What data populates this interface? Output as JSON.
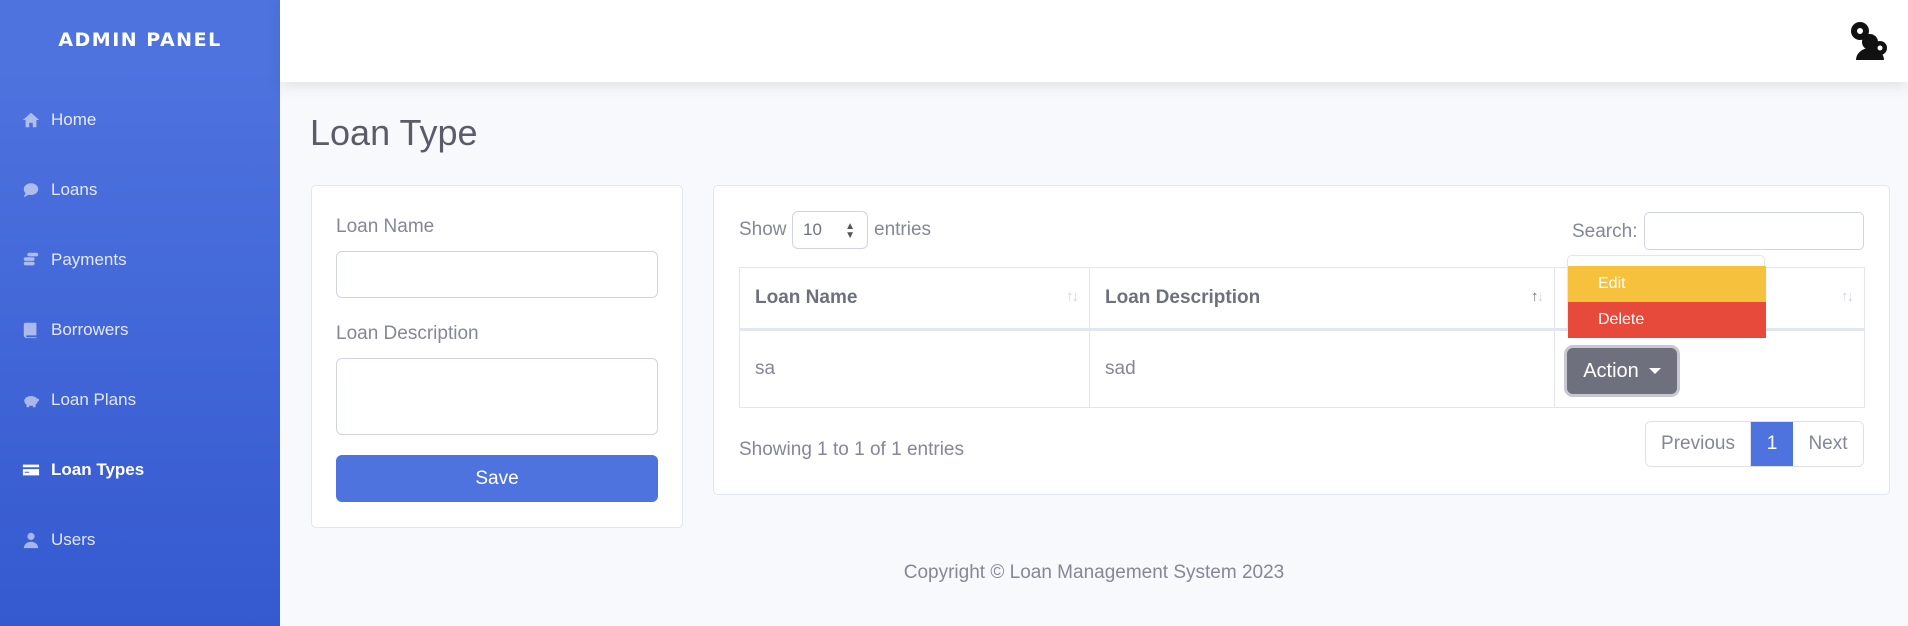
{
  "sidebar": {
    "brand": "ADMIN PANEL",
    "items": [
      {
        "label": "Home",
        "icon": "home-icon"
      },
      {
        "label": "Loans",
        "icon": "comment-dollar-icon"
      },
      {
        "label": "Payments",
        "icon": "coins-icon"
      },
      {
        "label": "Borrowers",
        "icon": "book-icon"
      },
      {
        "label": "Loan Plans",
        "icon": "piggy-bank-icon"
      },
      {
        "label": "Loan Types",
        "icon": "credit-card-icon",
        "active": true
      },
      {
        "label": "Users",
        "icon": "user-icon"
      }
    ]
  },
  "topbar": {
    "user_icon": "users-cog-icon"
  },
  "page": {
    "title": "Loan Type"
  },
  "form": {
    "loan_name_label": "Loan Name",
    "loan_name_value": "",
    "loan_description_label": "Loan Description",
    "loan_description_value": "",
    "save_label": "Save"
  },
  "table": {
    "show_label": "Show",
    "page_size": "10",
    "entries_label": "entries",
    "search_label": "Search:",
    "search_value": "",
    "columns": [
      "Loan Name",
      "Loan Description",
      ""
    ],
    "rows": [
      {
        "loan_name": "sa",
        "loan_description": "sad",
        "action_label": "Action"
      }
    ],
    "dropdown": {
      "edit_label": "Edit",
      "delete_label": "Delete"
    },
    "info": "Showing 1 to 1 of 1 entries",
    "pagination": {
      "previous": "Previous",
      "current": "1",
      "next": "Next"
    }
  },
  "footer": {
    "text": "Copyright © Loan Management System 2023"
  },
  "colors": {
    "primary": "#4e73df",
    "warning": "#f6c23e",
    "danger": "#e74a3b",
    "secondary": "#6e707e"
  }
}
